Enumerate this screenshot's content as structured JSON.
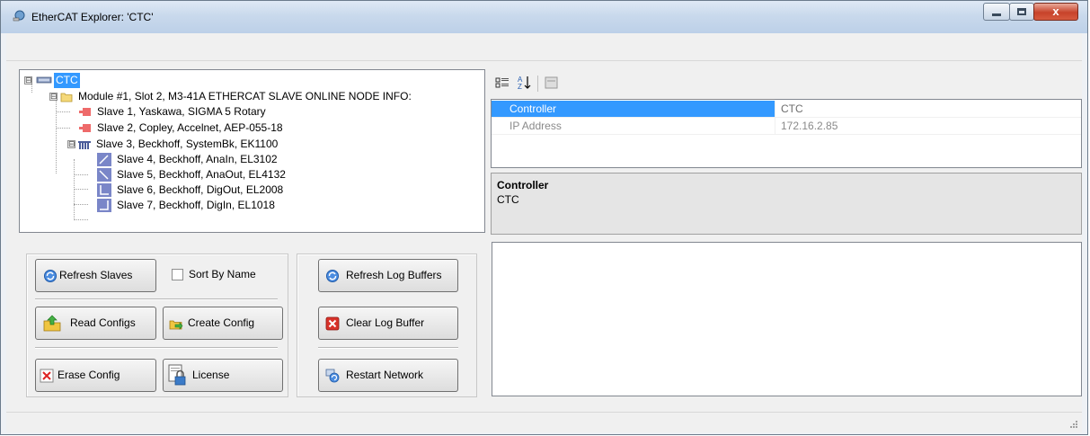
{
  "window": {
    "title": "EtherCAT Explorer: 'CTC'",
    "close_glyph": "x"
  },
  "tree": {
    "nodes": [
      {
        "label": "CTC",
        "icon": "controller-icon",
        "expander": "⊟"
      },
      {
        "label": "Module #1, Slot 2, M3-41A ETHERCAT SLAVE ONLINE NODE INFO:",
        "icon": "folder-icon",
        "expander": "⊟"
      },
      {
        "label": "Slave 1, Yaskawa, SIGMA 5 Rotary",
        "icon": "servo-icon"
      },
      {
        "label": "Slave 2, Copley, Accelnet, AEP-055-18",
        "icon": "servo-icon"
      },
      {
        "label": "Slave 3, Beckhoff, SystemBk, EK1100",
        "icon": "coupler-icon",
        "expander": "⊟"
      },
      {
        "label": "Slave 4, Beckhoff, AnaIn, EL3102",
        "icon": "analog-in-icon"
      },
      {
        "label": "Slave 5, Beckhoff, AnaOut, EL4132",
        "icon": "analog-out-icon"
      },
      {
        "label": "Slave 6, Beckhoff, DigOut, EL2008",
        "icon": "digital-out-icon"
      },
      {
        "label": "Slave 7, Beckhoff, DigIn, EL1018",
        "icon": "digital-in-icon"
      }
    ]
  },
  "property_grid": {
    "toolbar": {
      "categorized_icon": "categorized-icon",
      "alphabetical_icon": "sort-alpha-icon",
      "pages_icon": "property-pages-icon"
    },
    "rows": [
      {
        "name": "Controller",
        "value": "CTC"
      },
      {
        "name": "IP Address",
        "value": "172.16.2.85"
      }
    ],
    "description": {
      "title": "Controller",
      "text": "CTC"
    }
  },
  "buttons": {
    "refresh_slaves": "Refresh Slaves",
    "sort_by_name": "Sort By Name",
    "read_configs": "Read Configs",
    "create_config": "Create Config",
    "erase_config": "Erase Config",
    "license": "License",
    "refresh_log_buffers": "Refresh Log Buffers",
    "clear_log_buffer": "Clear Log Buffer",
    "restart_network": "Restart Network"
  }
}
